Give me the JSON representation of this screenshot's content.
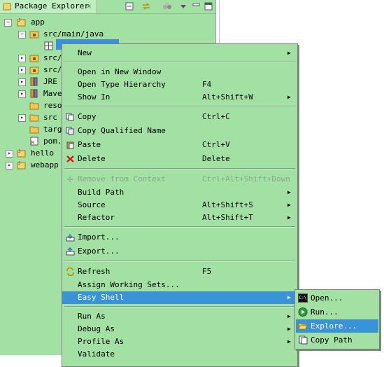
{
  "panel": {
    "title": "Package Explorer"
  },
  "tree": [
    {
      "label": "app"
    },
    {
      "label": "src/main/java"
    },
    {
      "label": ""
    },
    {
      "label": "src/"
    },
    {
      "label": "src/"
    },
    {
      "label": "JRE"
    },
    {
      "label": "Mave"
    },
    {
      "label": "reso"
    },
    {
      "label": "src"
    },
    {
      "label": "targ"
    },
    {
      "label": "pom."
    },
    {
      "label": "hello"
    },
    {
      "label": "webapp"
    }
  ],
  "menu": {
    "new": "New",
    "open_new_window": "Open in New Window",
    "open_type_hierarchy": "Open Type Hierarchy",
    "open_type_hierarchy_acc": "F4",
    "show_in": "Show In",
    "show_in_acc": "Alt+Shift+W",
    "copy": "Copy",
    "copy_acc": "Ctrl+C",
    "copy_qualified": "Copy Qualified Name",
    "paste": "Paste",
    "paste_acc": "Ctrl+V",
    "delete": "Delete",
    "delete_acc": "Delete",
    "remove_context": "Remove from Context",
    "remove_context_acc": "Ctrl+Alt+Shift+Down",
    "build_path": "Build Path",
    "source": "Source",
    "source_acc": "Alt+Shift+S",
    "refactor": "Refactor",
    "refactor_acc": "Alt+Shift+T",
    "import": "Import...",
    "export": "Export...",
    "refresh": "Refresh",
    "refresh_acc": "F5",
    "assign_working_sets": "Assign Working Sets...",
    "easy_shell": "Easy Shell",
    "run_as": "Run As",
    "debug_as": "Debug As",
    "profile_as": "Profile As",
    "validate": "Validate"
  },
  "submenu": {
    "open": "Open...",
    "run": "Run...",
    "explore": "Explore...",
    "copy_path": "Copy Path"
  },
  "colors": {
    "panel_bg": "#a3e0a4",
    "highlight": "#3993d6"
  }
}
